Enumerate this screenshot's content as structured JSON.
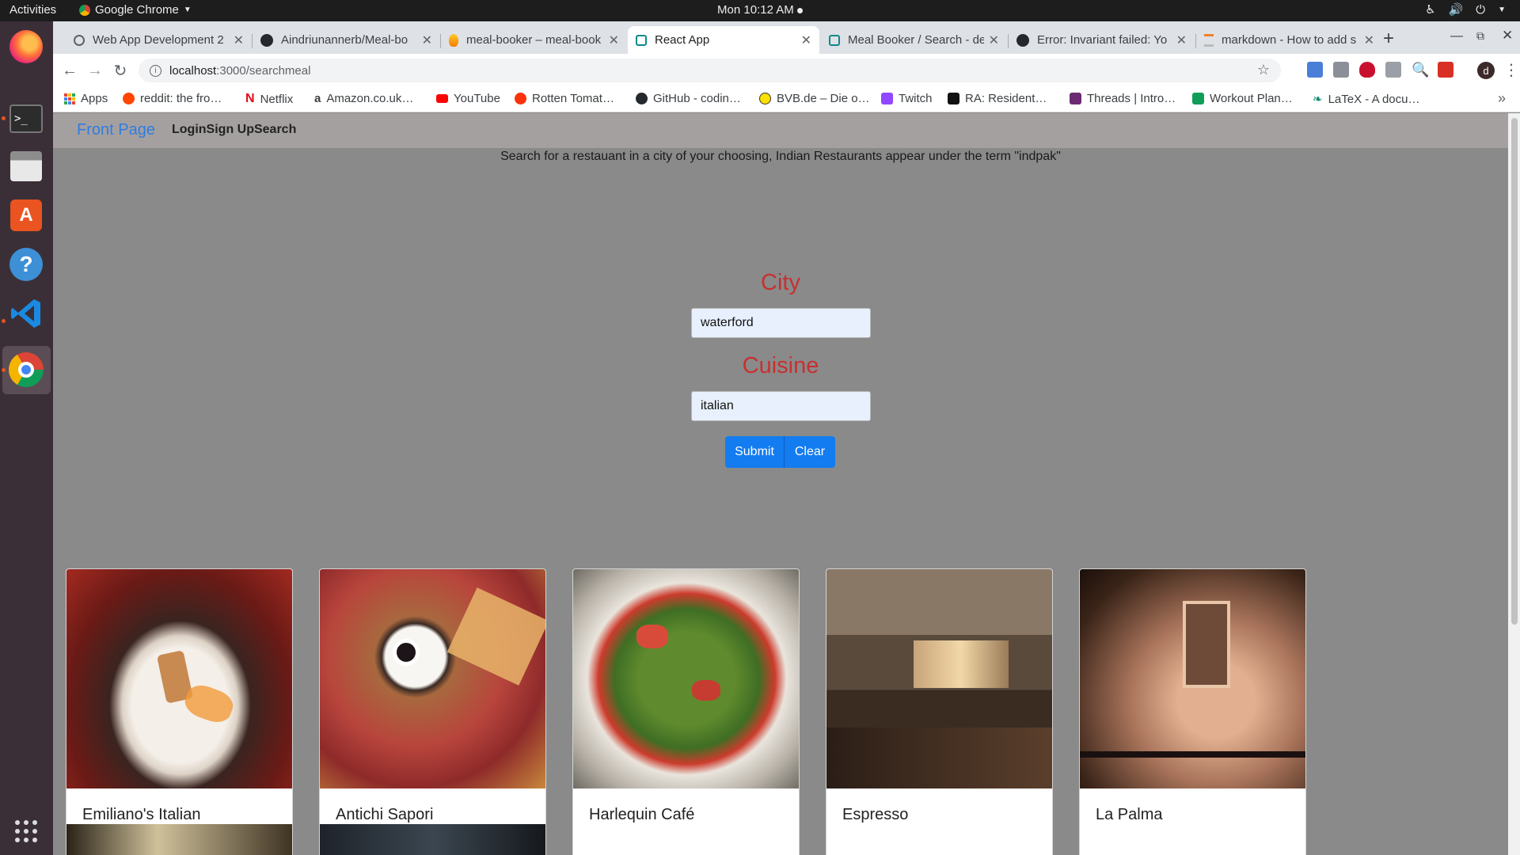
{
  "system": {
    "activities": "Activities",
    "app_menu": "Google Chrome",
    "clock": "Mon 10:12 AM"
  },
  "dock": {
    "items": [
      "Firefox",
      "Terminal",
      "Files",
      "Ubuntu Software",
      "Help",
      "Visual Studio Code",
      "Google Chrome",
      "Show Applications"
    ]
  },
  "browser": {
    "tabs": [
      {
        "title": "Web App Development 2",
        "icon": "globe-icon"
      },
      {
        "title": "Aindriunannerb/Meal-bo",
        "icon": "github-icon"
      },
      {
        "title": "meal-booker – meal-book",
        "icon": "flame-icon"
      },
      {
        "title": "React App",
        "icon": "react-icon",
        "active": true
      },
      {
        "title": "Meal Booker / Search - de",
        "icon": "react-icon"
      },
      {
        "title": "Error: Invariant failed: Yo",
        "icon": "github-icon"
      },
      {
        "title": "markdown - How to add s",
        "icon": "stackoverflow-icon"
      }
    ],
    "url_host": "localhost",
    "url_path": ":3000/searchmeal",
    "bookmarks": [
      {
        "label": "Apps",
        "color": "#e8453c"
      },
      {
        "label": "reddit: the fro…",
        "color": "#ff4500"
      },
      {
        "label": "Netflix",
        "color": "#e50914"
      },
      {
        "label": "Amazon.co.uk…",
        "color": "#222222"
      },
      {
        "label": "YouTube",
        "color": "#ff0000"
      },
      {
        "label": "Rotten Tomat…",
        "color": "#fa320a"
      },
      {
        "label": "GitHub - codin…",
        "color": "#24292e"
      },
      {
        "label": "BVB.de – Die o…",
        "color": "#fde100"
      },
      {
        "label": "Twitch",
        "color": "#9146ff"
      },
      {
        "label": "RA: Resident…",
        "color": "#111111"
      },
      {
        "label": "Threads | Intro…",
        "color": "#6b2a72"
      },
      {
        "label": "Workout Plan…",
        "color": "#0f9d58"
      },
      {
        "label": "LaTeX - A docu…",
        "color": "#138a72"
      }
    ],
    "bookmarks_overflow": "»",
    "profile_initial": "d"
  },
  "page": {
    "nav": {
      "brand": "Front Page",
      "links": [
        "Login",
        "Sign Up",
        "Search"
      ]
    },
    "intro": "Search for a restauant in a city of your choosing, Indian Restaurants appear under the term \"indpak\"",
    "form": {
      "city_label": "City",
      "city_value": "waterford",
      "cuisine_label": "Cuisine",
      "cuisine_value": "italian",
      "submit_label": "Submit",
      "clear_label": "Clear"
    },
    "results": [
      {
        "name": "Emiliano's Italian"
      },
      {
        "name": "Antichi Sapori"
      },
      {
        "name": "Harlequin Café"
      },
      {
        "name": "Espresso"
      },
      {
        "name": "La Palma"
      }
    ]
  },
  "colors": {
    "navbar_bg": "#a5a0a0",
    "page_bg": "#8a8a8a",
    "label_red": "#c8302f",
    "button_blue": "#137cf0",
    "brand_blue": "#2f7de0"
  }
}
